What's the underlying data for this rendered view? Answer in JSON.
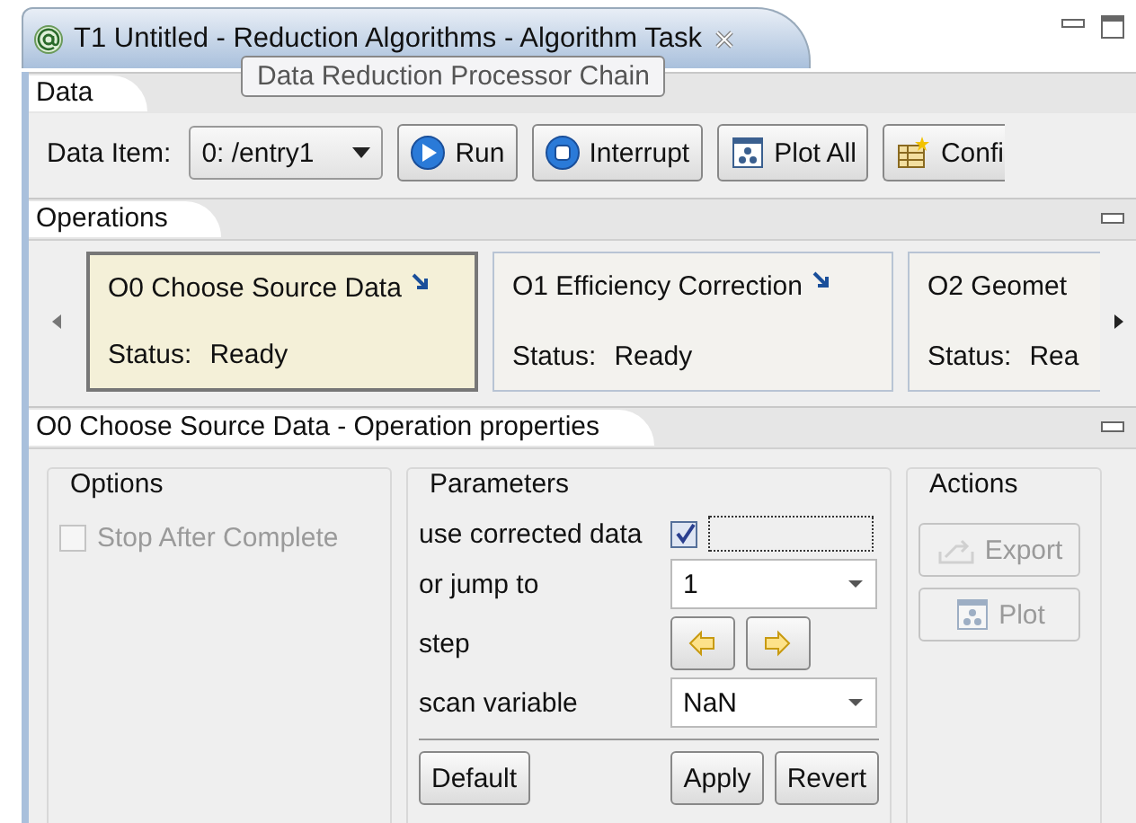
{
  "editor_tab": {
    "title": "T1 Untitled - Reduction Algorithms - Algorithm Task"
  },
  "tooltip": "Data Reduction Processor Chain",
  "data_section": {
    "tab": "Data",
    "data_item_label": "Data Item:",
    "data_item_value": "0: /entry1",
    "buttons": [
      {
        "kind": "run",
        "label": "Run"
      },
      {
        "kind": "interrupt",
        "label": "Interrupt"
      },
      {
        "kind": "plot",
        "label": "Plot All"
      },
      {
        "kind": "config",
        "label": "Confi"
      }
    ]
  },
  "operations": {
    "tab": "Operations",
    "items": [
      {
        "title": "O0 Choose Source Data",
        "status_label": "Status:",
        "status": "Ready",
        "selected": true
      },
      {
        "title": "O1 Efficiency Correction",
        "status_label": "Status:",
        "status": "Ready",
        "selected": false
      },
      {
        "title": "O2 Geomet",
        "status_label": "Status:",
        "status": "Rea",
        "selected": false
      }
    ]
  },
  "properties": {
    "tab": "O0 Choose Source Data - Operation properties",
    "options": {
      "title": "Options",
      "checkbox": {
        "label": "Stop After Complete",
        "checked": false,
        "disabled": true
      }
    },
    "parameters": {
      "title": "Parameters",
      "rows": [
        {
          "kind": "checkbox",
          "label": "use corrected data",
          "checked": true
        },
        {
          "kind": "combo",
          "label": "or jump to",
          "value": "1"
        },
        {
          "kind": "step",
          "label": "step"
        },
        {
          "kind": "combo",
          "label": "scan variable",
          "value": "NaN"
        }
      ],
      "buttons": [
        "Default",
        "Apply",
        "Revert"
      ]
    },
    "actions": {
      "title": "Actions",
      "buttons": [
        {
          "kind": "export",
          "label": "Export",
          "disabled": true
        },
        {
          "kind": "plot",
          "label": "Plot",
          "disabled": true
        }
      ]
    }
  }
}
